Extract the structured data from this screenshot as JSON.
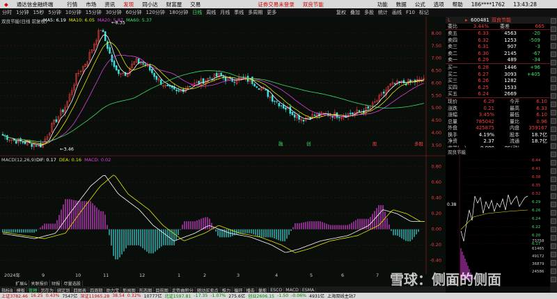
{
  "menubar": {
    "app_title": "通达信金融终端",
    "items": [
      "行情",
      "市场",
      "资讯",
      "发现",
      "同小达",
      "财富屋",
      "交易"
    ],
    "active": "发现",
    "notice": "证券交易未登录",
    "notice_stock": "双良节能",
    "right_items": [
      "功能",
      "数据",
      "公式",
      "选项",
      "帮助"
    ],
    "phone": "186****1762",
    "time": "13:43:28"
  },
  "periodbar": {
    "items": [
      "分时",
      "1分钟",
      "15秒",
      "5分钟",
      "10分钟",
      "15分钟",
      "30分钟",
      "60分钟",
      "120分钟",
      "180分钟",
      "日线",
      "周线",
      "月线",
      "季线",
      "多周期",
      "更多"
    ],
    "active": "日线"
  },
  "rightbar": {
    "items": [
      "复权",
      "叠加",
      "多股",
      "统计",
      "画线",
      "F10",
      "标记"
    ]
  },
  "chart": {
    "title": "双良节能(日线 前复权)",
    "ma_labels": [
      {
        "text": "MA5: 6.19",
        "color": "#ffffff"
      },
      {
        "text": "MA10: 6.05",
        "color": "#e8e800"
      },
      {
        "text": "MA20: 5.87",
        "color": "#e040e0"
      },
      {
        "text": "MA60: 5.37",
        "color": "#3ce06a"
      }
    ],
    "high_label": "8.35",
    "low_label": "3.46",
    "price_axis": [
      "8.00",
      "7.50",
      "7.00",
      "6.50",
      "6.00",
      "5.50",
      "5.00",
      "4.50",
      "4.00",
      "3.50"
    ],
    "macd_title": "MACD(12,26,9)",
    "macd_vals": [
      {
        "text": "DIF: 0.17",
        "color": "#ffffff"
      },
      {
        "text": "DEA: 0.16",
        "color": "#e8e800"
      },
      {
        "text": "MACD: 0.02",
        "color": "#e040e0"
      }
    ],
    "macd_axis": [
      "0.80",
      "0.60",
      "0.40",
      "0.20",
      "0.00",
      "-0.20",
      "-0.40"
    ],
    "date_axis": [
      "2024年",
      "9",
      "10",
      "11",
      "12",
      "1",
      "2",
      "3",
      "4",
      "5",
      "6",
      "7",
      "8"
    ],
    "markers": [
      {
        "text": "融",
        "color": "#3ce06a"
      },
      {
        "text": "创",
        "color": "#3ce06a"
      },
      {
        "text": "股",
        "color": "#f04040"
      },
      {
        "text": "多股",
        "color": "#f04040"
      }
    ]
  },
  "toolbar": {
    "items": [
      "指标B",
      "模板",
      "管理",
      "另存为",
      "绑定到",
      "四图表",
      "四周期",
      "助力宝",
      "新闻图",
      "形态图",
      "目前图",
      "走势曲积分",
      "随动买卖点",
      "推力",
      "循环",
      "播击",
      "量能",
      "ESCO",
      "MACD",
      "ESMA"
    ],
    "active": "管理",
    "sub_items": [
      "扩展&",
      "关联报价",
      "财报",
      "尽量选股"
    ]
  },
  "quote": {
    "code": "600481",
    "name": "双良节能",
    "weibi_label": "委比",
    "weibi_value": "3.44%",
    "weicha_label": "委差",
    "weicha_value": "665",
    "asks": [
      {
        "label": "卖五",
        "price": "6.33",
        "vol": "4563",
        "chg": "-20"
      },
      {
        "label": "卖四",
        "price": "6.32",
        "vol": "1253",
        "chg": "-509"
      },
      {
        "label": "卖三",
        "price": "6.31",
        "vol": "907",
        "chg": "-3"
      },
      {
        "label": "卖二",
        "price": "6.30",
        "vol": "2145",
        "chg": "-67"
      },
      {
        "label": "卖一",
        "price": "6.29",
        "vol": "489",
        "chg": "-34"
      }
    ],
    "bids": [
      {
        "label": "买一",
        "price": "6.28",
        "vol": "1446",
        "chg": "+96"
      },
      {
        "label": "买二",
        "price": "6.27",
        "vol": "3093",
        "chg": "+405"
      },
      {
        "label": "买三",
        "price": "6.26",
        "vol": "1282",
        "chg": ""
      },
      {
        "label": "买四",
        "price": "6.25",
        "vol": "1533",
        "chg": ""
      },
      {
        "label": "买五",
        "price": "6.24",
        "vol": "2669",
        "chg": ""
      }
    ],
    "stats": [
      {
        "l1": "现价",
        "v1": "6.29",
        "l2": "今开",
        "v2": "6.10"
      },
      {
        "l1": "涨跌",
        "v1": "0.21",
        "l2": "最高",
        "v2": "6.33"
      },
      {
        "l1": "涨幅",
        "v1": "3.45%",
        "l2": "最低",
        "v2": "6.10"
      },
      {
        "l1": "总量",
        "v1": "785042",
        "l2": "量比",
        "v2": "0.96"
      },
      {
        "l1": "外盘",
        "v1": "425875",
        "l2": "内盘",
        "v2": "359167"
      },
      {
        "l1": "换手",
        "v1": "4.19%",
        "l2": "股本",
        "v2": "18.7亿"
      },
      {
        "l1": "净资",
        "v1": "2.37",
        "l2": "流通",
        "v2": "18.7亿"
      },
      {
        "l1": "收益(一)",
        "v1": "-0.090",
        "l2": "PE(动)",
        "v2": ""
      }
    ]
  },
  "mini": {
    "title": "双良节能",
    "left_label": "0.38",
    "price_axis": [
      "6.44",
      "6.41",
      "6.38",
      "6.35",
      "6.32",
      "6.29",
      "6.26",
      "6.24",
      "6.22",
      "6.20",
      "6.17"
    ],
    "vol_axis": [
      "73758",
      "61465",
      "49172",
      "36879",
      "24586"
    ],
    "time_label": "时间"
  },
  "statusbar": {
    "items": [
      {
        "text": "上证3782.46",
        "cls": "up"
      },
      {
        "text": "16.25",
        "cls": "up"
      },
      {
        "text": "0.43%",
        "cls": "up"
      },
      {
        "text": "7547亿",
        "cls": ""
      },
      {
        "text": "深证11965.28",
        "cls": "up"
      },
      {
        "text": "38.54",
        "cls": "up"
      },
      {
        "text": "0.32%",
        "cls": "up"
      },
      {
        "text": "10777亿",
        "cls": ""
      },
      {
        "text": "北证1597.81",
        "cls": "dn"
      },
      {
        "text": "-17.35",
        "cls": "dn"
      },
      {
        "text": "-1.07%",
        "cls": "dn"
      },
      {
        "text": "275.6亿",
        "cls": ""
      },
      {
        "text": "创业2606.15",
        "cls": "dn"
      },
      {
        "text": "-1.50",
        "cls": "dn"
      },
      {
        "text": "-0.06%",
        "cls": "dn"
      },
      {
        "text": "4931亿",
        "cls": ""
      },
      {
        "text": "上海双线主站7",
        "cls": ""
      }
    ]
  },
  "watermark": "雪球：侧面的侧面",
  "colors": {
    "up": "#f04040",
    "down": "#3ce06a",
    "bg": "#0a0e0a",
    "grid": "#6a1a1a"
  }
}
